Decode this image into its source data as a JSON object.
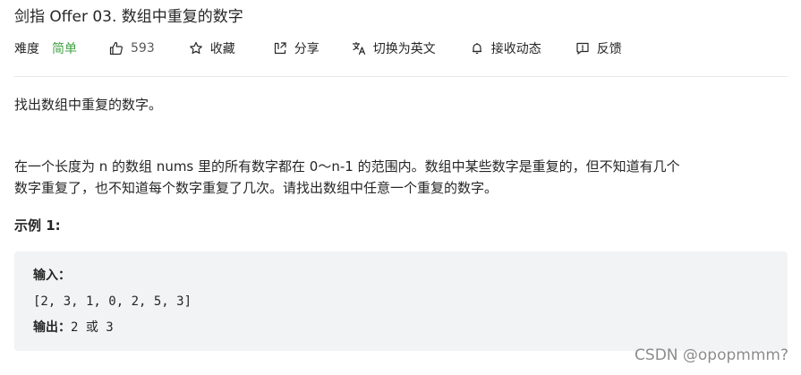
{
  "problem": {
    "title": "剑指 Offer 03. 数组中重复的数字"
  },
  "meta": {
    "difficulty_label": "难度",
    "difficulty_value": "简单",
    "likes": "593",
    "collect_label": "收藏",
    "share_label": "分享",
    "translate_label": "切换为英文",
    "subscribe_label": "接收动态",
    "feedback_label": "反馈",
    "difficulty_color": "#43a047"
  },
  "icons": {
    "like": "thumbs-up-icon",
    "collect": "star-icon",
    "share": "share-icon",
    "translate": "translate-icon",
    "subscribe": "bell-icon",
    "feedback": "feedback-icon"
  },
  "description": {
    "intro": "找出数组中重复的数字。",
    "detail_line1": "在一个长度为 n 的数组 nums 里的所有数字都在 0～n-1 的范围内。数组中某些数字是重复的，但不知道有几个",
    "detail_line2": "数字重复了，也不知道每个数字重复了几次。请找出数组中任意一个重复的数字。"
  },
  "example": {
    "heading": "示例 1:",
    "input_label": "输入：",
    "input_value": "[2, 3, 1, 0, 2, 5, 3]",
    "output_label": "输出：",
    "output_value": "2 或 3"
  },
  "watermark": "CSDN @opopmmm?"
}
